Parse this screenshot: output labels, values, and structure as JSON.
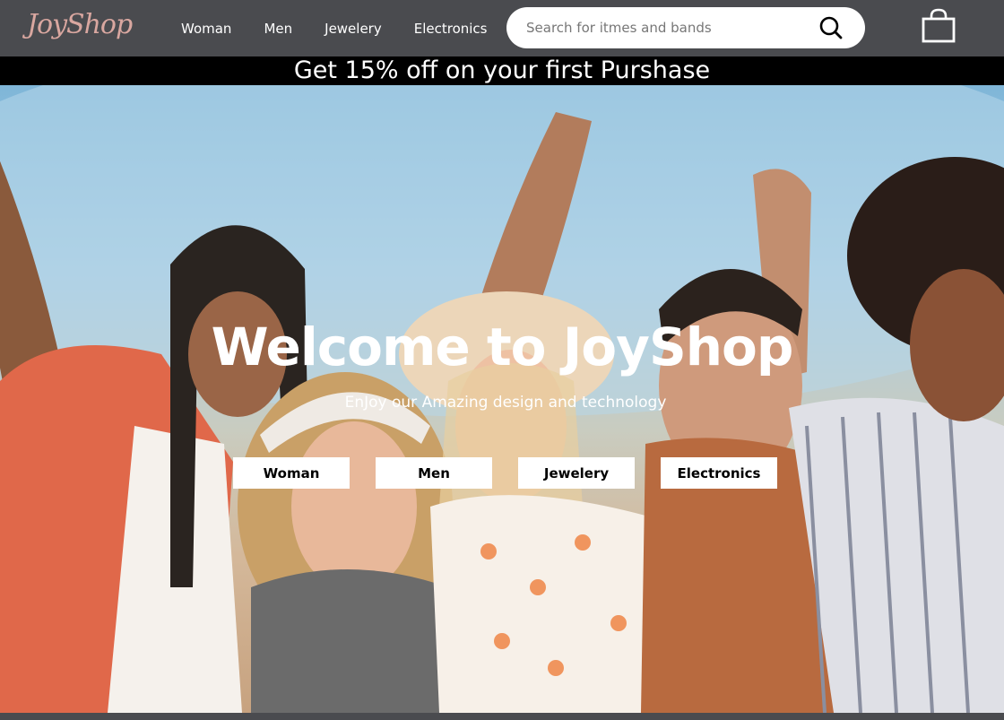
{
  "brand": {
    "logo_text": "JoyShop",
    "logo_color": "#d9a7a0"
  },
  "nav": {
    "links": [
      "Woman",
      "Men",
      "Jewelery",
      "Electronics"
    ],
    "background": "#4a4b4f"
  },
  "search": {
    "placeholder": "Search for itmes and bands",
    "icon": "search-icon"
  },
  "cart": {
    "icon": "shopping-bag-icon"
  },
  "promo": {
    "text": "Get 15% off on your first Purshase"
  },
  "hero": {
    "title": "Welcome to JoyShop",
    "subtitle": "EnJoy our Amazing design and technology",
    "buttons": [
      "Woman",
      "Men",
      "Jewelery",
      "Electronics"
    ]
  }
}
